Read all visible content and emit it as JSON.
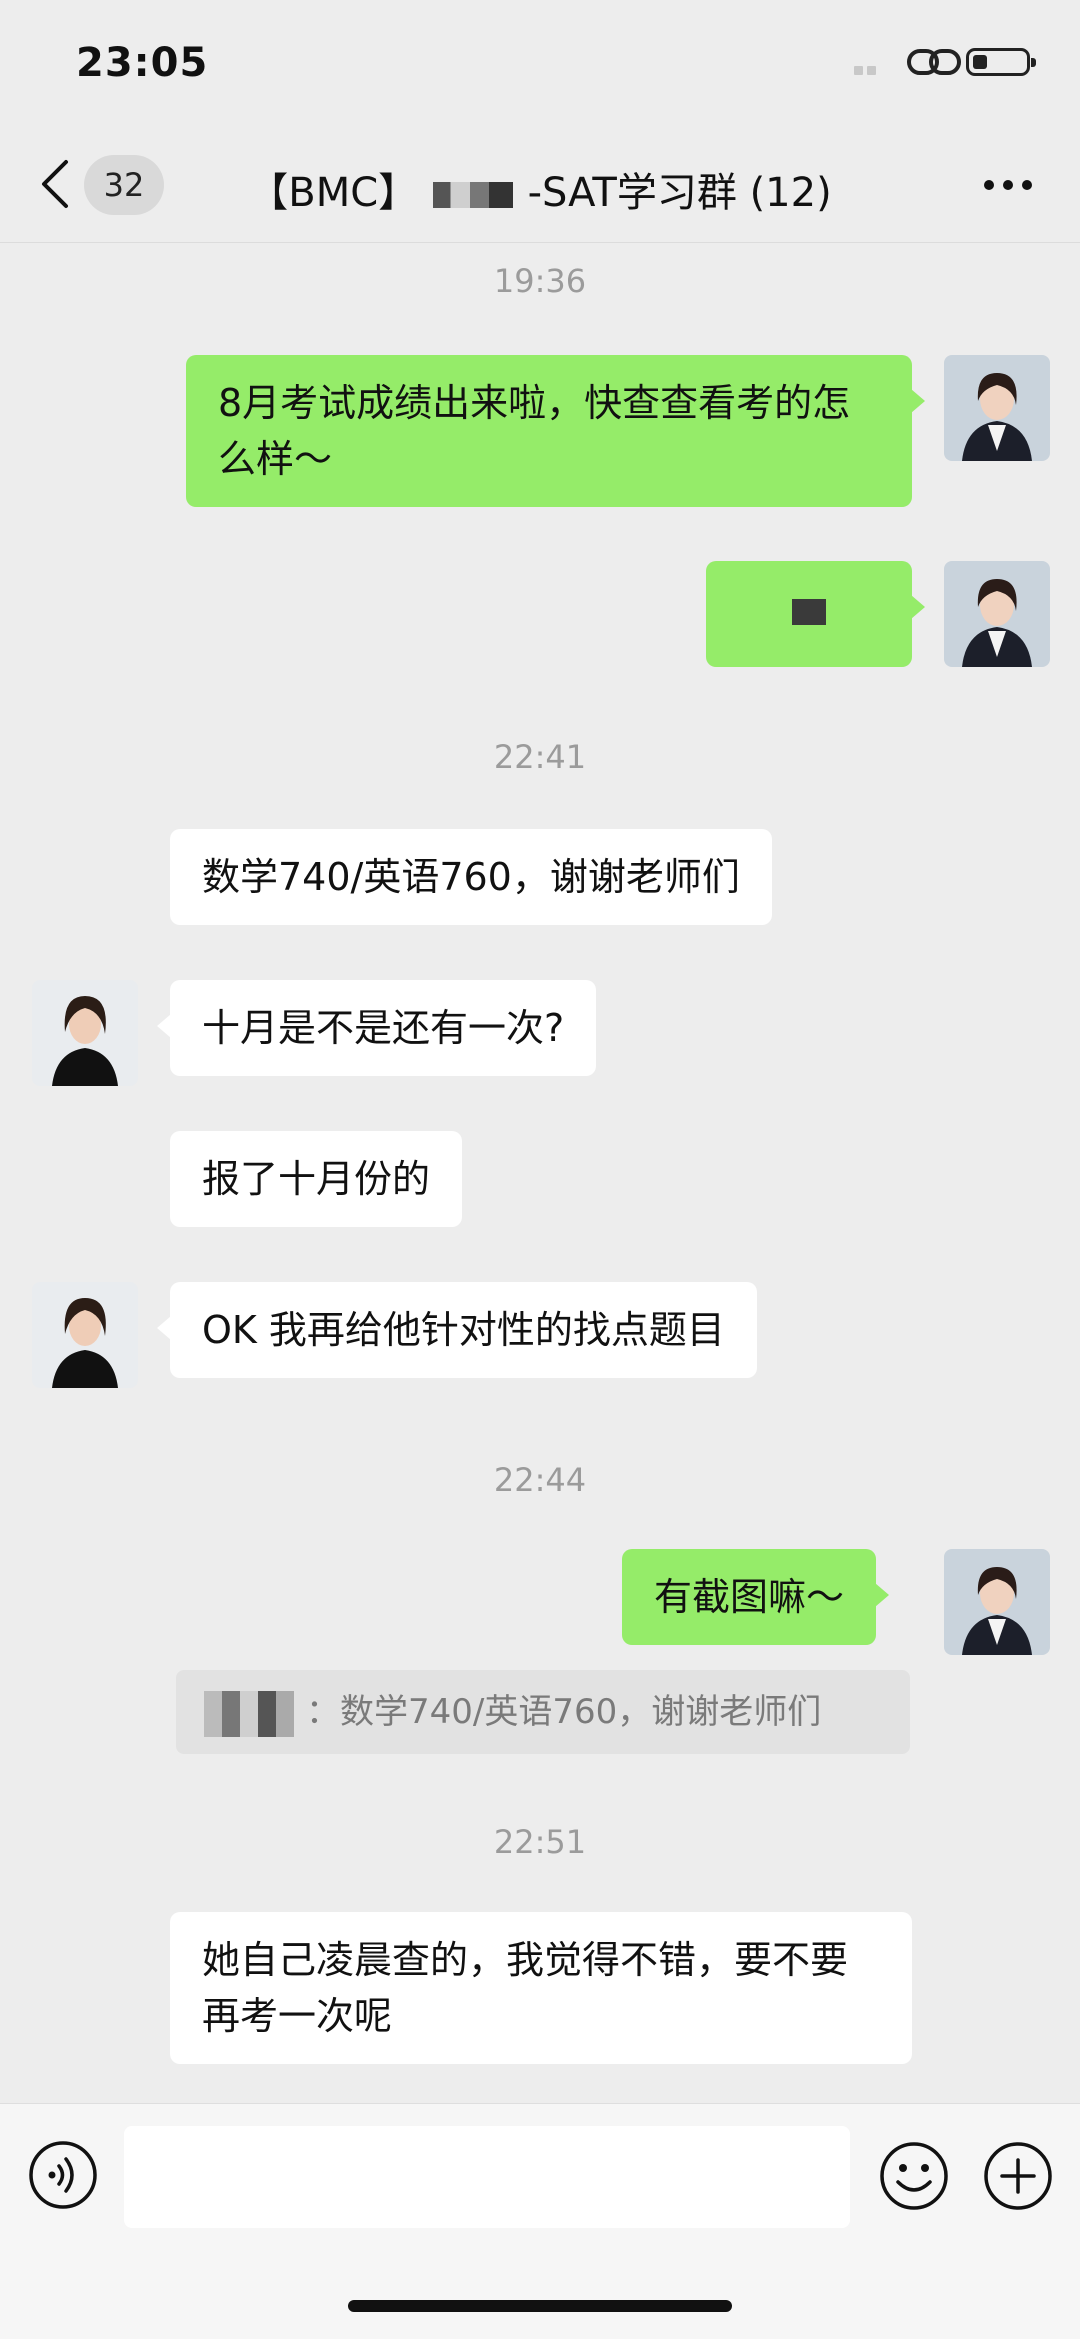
{
  "status_bar": {
    "time": "23:05"
  },
  "header": {
    "back_badge": "32",
    "title_prefix": "【BMC】",
    "title_suffix": "-SAT学习群 (12)",
    "more_icon": "more-icon"
  },
  "messages": [
    {
      "type": "time",
      "text": "19:36"
    },
    {
      "type": "msg",
      "side": "right",
      "text": "8月考试成绩出来啦，快查查看考的怎么样～"
    },
    {
      "type": "msg",
      "side": "right",
      "text": ""
    },
    {
      "type": "time",
      "text": "22:41"
    },
    {
      "type": "msg",
      "side": "left",
      "text": "数学740/英语760，谢谢老师们"
    },
    {
      "type": "msg",
      "side": "left",
      "text": "十月是不是还有一次?"
    },
    {
      "type": "msg",
      "side": "left",
      "text": "报了十月份的"
    },
    {
      "type": "msg",
      "side": "left",
      "text": "OK 我再给他针对性的找点题目"
    },
    {
      "type": "time",
      "text": "22:44"
    },
    {
      "type": "msg",
      "side": "right",
      "text": "有截图嘛～"
    },
    {
      "type": "quote",
      "text": "：数学740/英语760，谢谢老师们"
    },
    {
      "type": "time",
      "text": "22:51"
    },
    {
      "type": "msg",
      "side": "left",
      "text": "她自己凌晨查的，我觉得不错，要不要再考一次呢"
    }
  ],
  "input_bar": {
    "placeholder": "",
    "icons": [
      "voice-icon",
      "emoji-icon",
      "plus-icon"
    ]
  },
  "colors": {
    "background": "#ededed",
    "my_bubble": "#95ec69",
    "other_bubble": "#ffffff",
    "timestamp": "#9b9b9b"
  }
}
